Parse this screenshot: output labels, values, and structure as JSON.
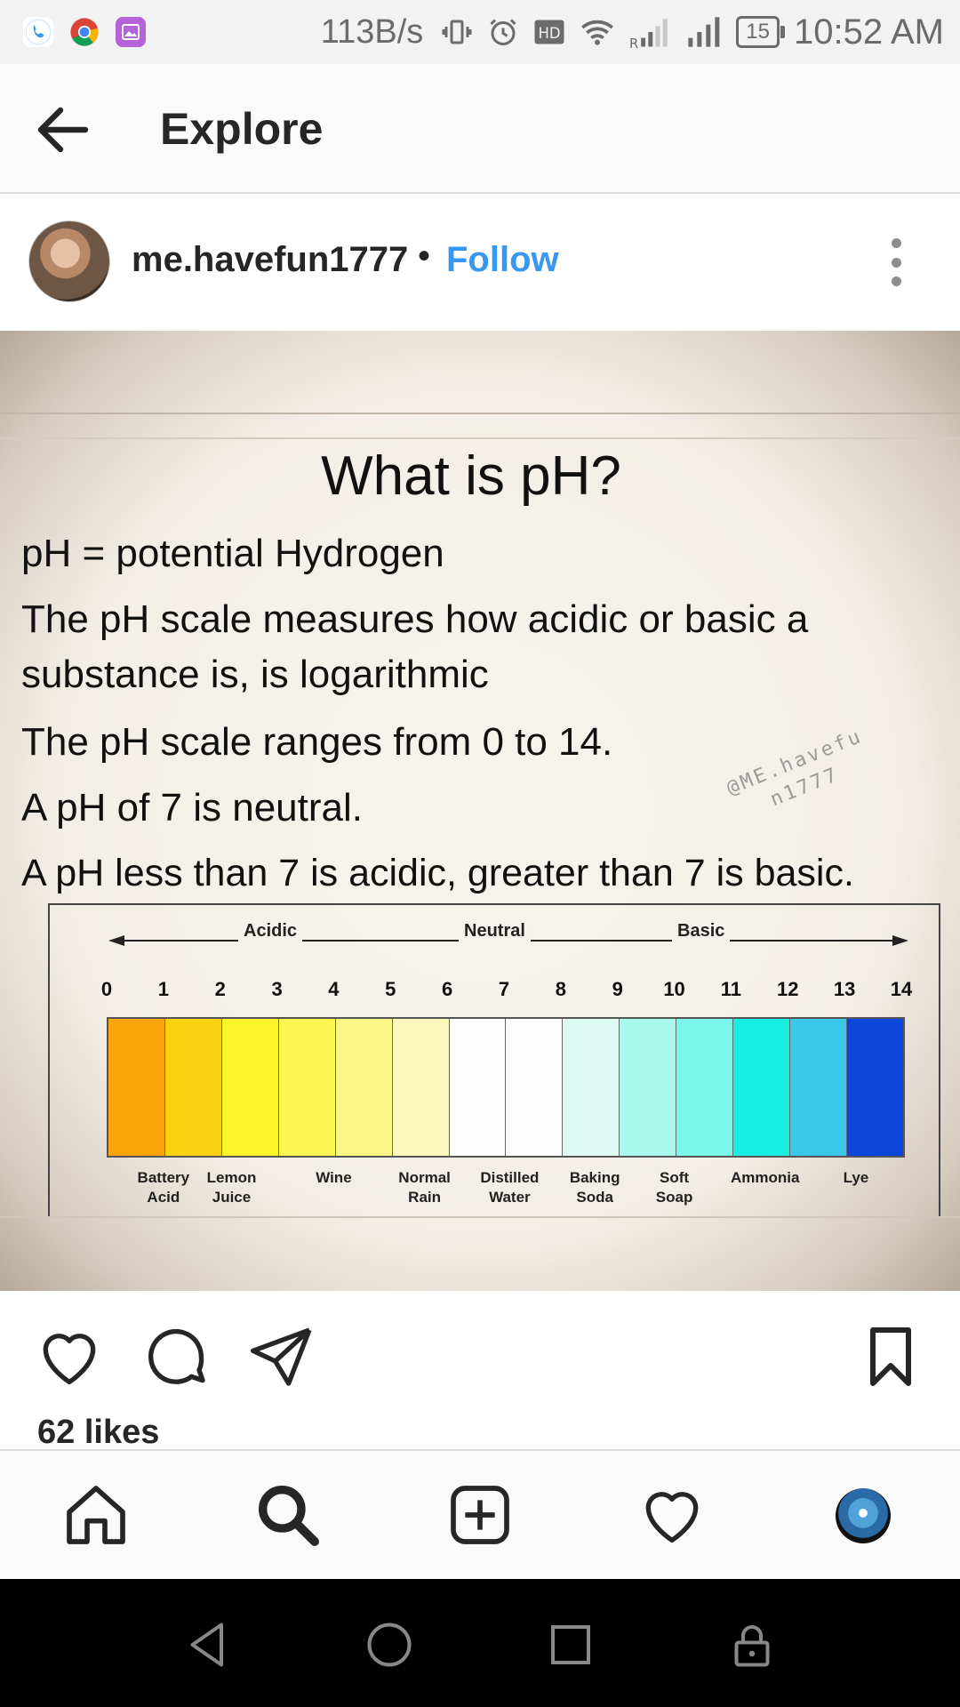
{
  "status_bar": {
    "net_speed": "113B/s",
    "battery": "15",
    "time": "10:52 AM",
    "icons": [
      "phone-icon",
      "chrome-icon",
      "gallery-icon",
      "vibrate-icon",
      "alarm-icon",
      "hd-icon",
      "wifi-icon",
      "signal-icon",
      "signal-icon",
      "battery-icon"
    ]
  },
  "header": {
    "title": "Explore"
  },
  "post": {
    "username": "me.havefun1777",
    "separator": "•",
    "follow_label": "Follow",
    "likes": "62 likes"
  },
  "image": {
    "title": "What is pH?",
    "lines": [
      "pH = potential Hydrogen",
      "The pH scale measures how acidic or basic a",
      "substance is, is logarithmic",
      "The pH scale ranges from 0 to 14.",
      "A pH of 7 is neutral.",
      "A pH less than 7 is acidic, greater than 7 is basic."
    ],
    "watermark_1": "@ME.havefu",
    "watermark_2": "n1777",
    "scale_labels": {
      "acidic": "Acidic",
      "neutral": "Neutral",
      "basic": "Basic"
    },
    "ph_values": [
      "0",
      "1",
      "2",
      "3",
      "4",
      "5",
      "6",
      "7",
      "8",
      "9",
      "10",
      "11",
      "12",
      "13",
      "14"
    ],
    "bar_colors": [
      "#fba50c",
      "#fbd20f",
      "#fdf52a",
      "#fdf550",
      "#fbf787",
      "#fbf8bd",
      "#fefefe",
      "#fefefe",
      "#dcfaf2",
      "#a9f8ee",
      "#7bf6ea",
      "#16efe2",
      "#3bc7ea",
      "#0a46da"
    ],
    "substances": [
      {
        "l1": "Battery",
        "l2": "Acid"
      },
      {
        "l1": "Lemon",
        "l2": "Juice"
      },
      {
        "l1": "Wine",
        "l2": ""
      },
      {
        "l1": "Normal",
        "l2": "Rain"
      },
      {
        "l1": "Distilled",
        "l2": "Water"
      },
      {
        "l1": "Baking",
        "l2": "Soda"
      },
      {
        "l1": "Soft",
        "l2": "Soap"
      },
      {
        "l1": "Ammonia",
        "l2": ""
      },
      {
        "l1": "Lye",
        "l2": ""
      }
    ]
  },
  "icons": {
    "back": "back-arrow-icon",
    "more": "more-options-icon",
    "like": "heart-icon",
    "comment": "comment-icon",
    "share": "send-icon",
    "save": "bookmark-icon",
    "home": "home-icon",
    "search": "search-icon",
    "new_post": "add-post-icon",
    "activity": "heart-icon",
    "profile": "profile-icon"
  }
}
